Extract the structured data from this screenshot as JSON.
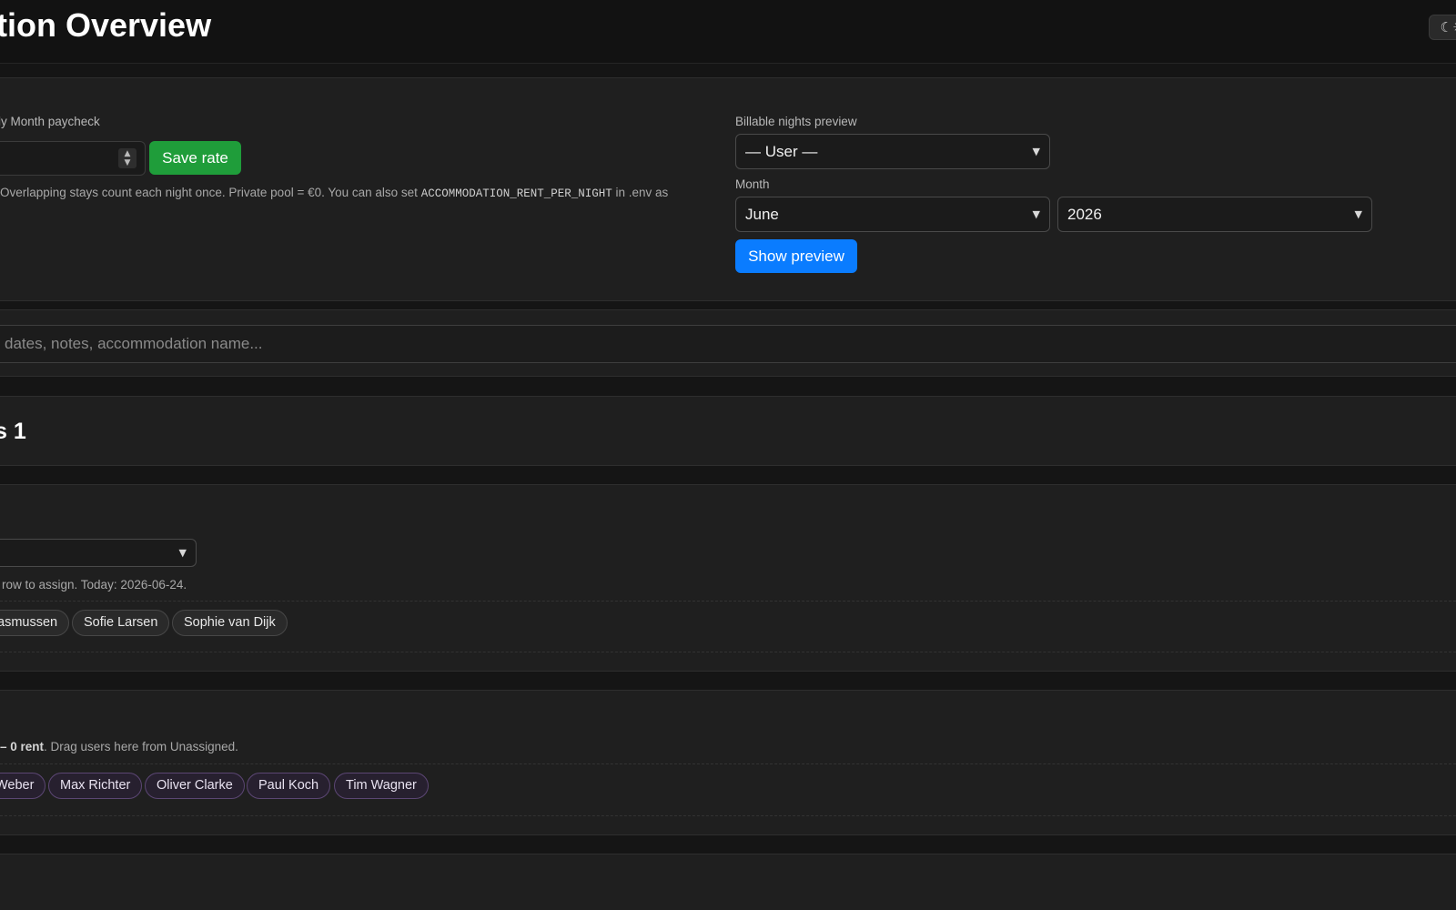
{
  "header": {
    "title": "tion Overview",
    "theme_toggle": "☾☀"
  },
  "rate": {
    "label": "ly Month paycheck",
    "save_label": "Save rate",
    "hint_prefix": "Overlapping stays count each night once. Private pool = €0. You can also set",
    "hint_code": "ACCOMMODATION_RENT_PER_NIGHT",
    "hint_suffix": "in .env as"
  },
  "preview": {
    "label": "Billable nights preview",
    "user_select": "— User —",
    "month_label": "Month",
    "month_select": "June",
    "year_select": "2026",
    "show_label": "Show preview"
  },
  "search": {
    "placeholder": "dates, notes, accommodation name..."
  },
  "group": {
    "title": "s 1"
  },
  "unassigned": {
    "hint": "row to assign. Today: 2026-06-24.",
    "chips": [
      "asmussen",
      "Sofie Larsen",
      "Sophie van Dijk"
    ]
  },
  "pool": {
    "hint_bold": "– 0 rent",
    "hint_rest": ". Drag users here from Unassigned.",
    "chips": [
      "Weber",
      "Max Richter",
      "Oliver Clarke",
      "Paul Koch",
      "Tim Wagner"
    ]
  },
  "colors": {
    "background": "#151515",
    "panel": "#1f1f1f",
    "save_button": "#1f9d3a",
    "preview_button": "#0a7cff",
    "member_chip_border": "#5b4673"
  },
  "icons": {
    "theme": "moon-sun-icon",
    "select": "chevron-down-icon",
    "spinner": "up-down-spinner-icon"
  }
}
